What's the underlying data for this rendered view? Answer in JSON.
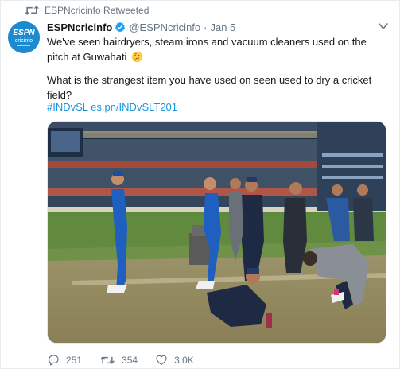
{
  "retweet": {
    "label": "ESPNcricinfo Retweeted"
  },
  "author": {
    "avatar_text_top": "ESPN",
    "avatar_text_bottom": "cricinfo",
    "name": "ESPNcricinfo",
    "handle": "@ESPNcricinfo",
    "separator": "·",
    "date": "Jan 5"
  },
  "tweet": {
    "line1": "We've seen hairdryers, steam irons and vacuum cleaners used on the pitch at Guwahati",
    "line2": "What is the strangest item you have used on seen used to dry a cricket field?",
    "links": "#INDvSL es.pn/INDvSLT201",
    "emoji": "thinking-face-icon"
  },
  "actions": {
    "replies": "251",
    "retweets": "354",
    "likes": "3.0K"
  },
  "colors": {
    "accent": "#1b95e0",
    "muted": "#657786",
    "retweet_green": "#17bf63",
    "brand": "#1c8ad1"
  }
}
